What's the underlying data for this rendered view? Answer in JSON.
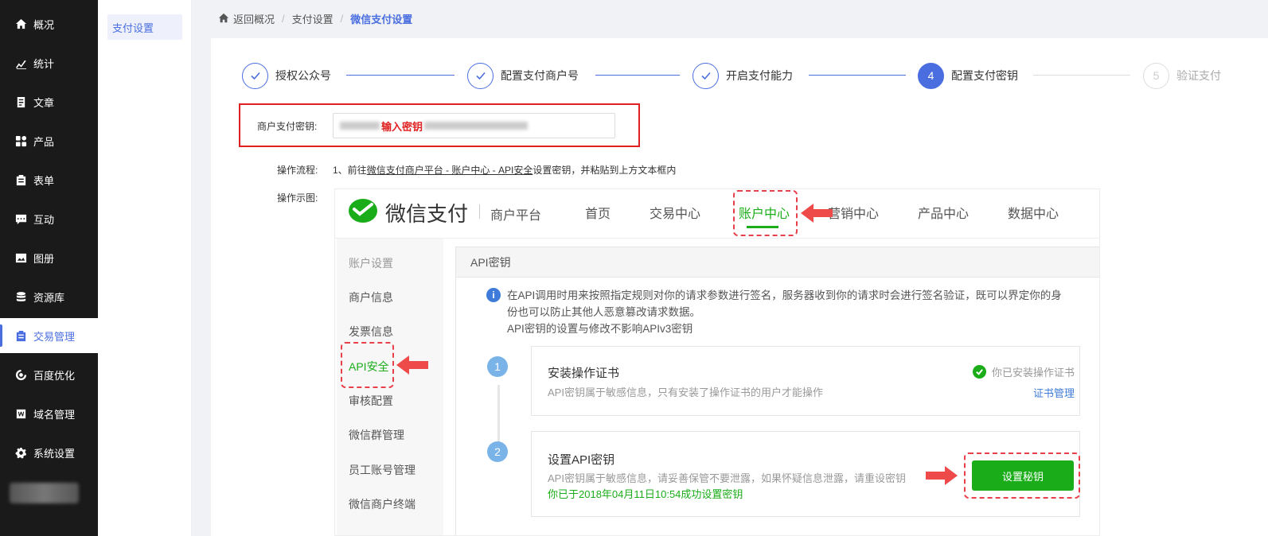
{
  "sidebar": {
    "items": [
      {
        "label": "概况",
        "icon": "home-icon"
      },
      {
        "label": "统计",
        "icon": "chart-icon"
      },
      {
        "label": "文章",
        "icon": "article-icon"
      },
      {
        "label": "产品",
        "icon": "grid-icon"
      },
      {
        "label": "表单",
        "icon": "clipboard-icon"
      },
      {
        "label": "互动",
        "icon": "chat-icon"
      },
      {
        "label": "图册",
        "icon": "gallery-icon"
      },
      {
        "label": "资源库",
        "icon": "database-icon"
      },
      {
        "label": "交易管理",
        "icon": "clipboard-icon"
      },
      {
        "label": "百度优化",
        "icon": "optimize-icon"
      },
      {
        "label": "域名管理",
        "icon": "domain-icon"
      },
      {
        "label": "系统设置",
        "icon": "gear-icon"
      }
    ],
    "active_index": 8
  },
  "subnav": {
    "item": "支付设置"
  },
  "breadcrumb": {
    "home": "返回概况",
    "middle": "支付设置",
    "current": "微信支付设置",
    "separator": "/"
  },
  "steps": [
    {
      "label": "授权公众号",
      "state": "done"
    },
    {
      "label": "配置支付商户号",
      "state": "done"
    },
    {
      "label": "开启支付能力",
      "state": "done"
    },
    {
      "label": "配置支付密钥",
      "number": "4",
      "state": "current"
    },
    {
      "label": "验证支付",
      "number": "5",
      "state": "pending"
    }
  ],
  "key": {
    "label": "商户支付密钥:",
    "value_hint": "输入密钥"
  },
  "process": {
    "label": "操作流程:",
    "prefix": "1、前往",
    "link": "微信支付商户平台 - 账户中心 - API安全",
    "suffix": "设置密钥，并粘贴到上方文本框内"
  },
  "demo_label": "操作示图:",
  "demo": {
    "brand": "微信支付",
    "platform": "商户平台",
    "tabs": [
      "首页",
      "交易中心",
      "账户中心",
      "营销中心",
      "产品中心",
      "数据中心"
    ],
    "active_tab": 2,
    "left_items": [
      "账户设置",
      "商户信息",
      "发票信息",
      "API安全",
      "审核配置",
      "微信群管理",
      "员工账号管理",
      "微信商户终端"
    ],
    "panel_title": "API密钥",
    "info_lines": [
      "在API调用时用来按照指定规则对你的请求参数进行签名，服务器收到你的请求时会进行签名验证，既可以界定你的身",
      "份也可以防止其他人恶意篡改请求数据。",
      "API密钥的设置与修改不影响APIv3密钥"
    ],
    "info_icon": "i",
    "step1": {
      "number": "1",
      "title": "安装操作证书",
      "desc": "API密钥属于敏感信息，只有安装了操作证书的用户才能操作",
      "status": "你已安装操作证书",
      "link": "证书管理"
    },
    "step2": {
      "number": "2",
      "title": "设置API密钥",
      "desc": "API密钥属于敏感信息，请妥善保管不要泄露，如果怀疑信息泄露，请重设密钥",
      "ok": "你已于2018年04月11日10:54成功设置密钥",
      "button": "设置秘钥"
    }
  },
  "colors": {
    "accent": "#4a6ee0",
    "wechat_green": "#1aad19",
    "highlight_red": "#e02020",
    "sidebar_bg": "#1a1a1a"
  }
}
